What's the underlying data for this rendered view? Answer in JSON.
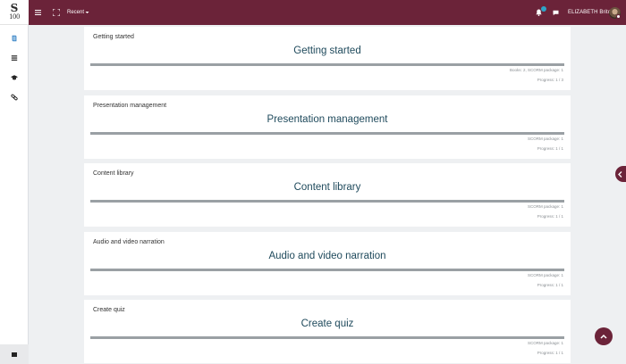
{
  "logo": {
    "top": "S",
    "bottom": "100"
  },
  "topbar": {
    "recent_label": "Recent",
    "notifications_count": "",
    "username": "ELIZABETH Brito"
  },
  "sidebar": {
    "items": [
      {
        "icon": "book-icon"
      },
      {
        "icon": "list-icon"
      },
      {
        "icon": "graduation-cap-icon"
      },
      {
        "icon": "link-icon"
      }
    ]
  },
  "cards": [
    {
      "label": "Getting started",
      "title": "Getting started",
      "meta": "Books: 2, SCORM package: 1",
      "progress": "Progress: 1 / 3"
    },
    {
      "label": "Presentation management",
      "title": "Presentation management",
      "meta": "SCORM package: 1",
      "progress": "Progress: 1 / 1"
    },
    {
      "label": "Content library",
      "title": "Content library",
      "meta": "SCORM package: 1",
      "progress": "Progress: 1 / 1"
    },
    {
      "label": "Audio and video narration",
      "title": "Audio and video narration",
      "meta": "SCORM package: 1",
      "progress": "Progress: 1 / 1"
    },
    {
      "label": "Create quiz",
      "title": "Create quiz",
      "meta": "SCORM package: 1",
      "progress": "Progress: 1 / 1"
    }
  ],
  "colors": {
    "brand": "#6b2339",
    "title": "#1f4a5c",
    "bar": "#9aa0a4"
  }
}
